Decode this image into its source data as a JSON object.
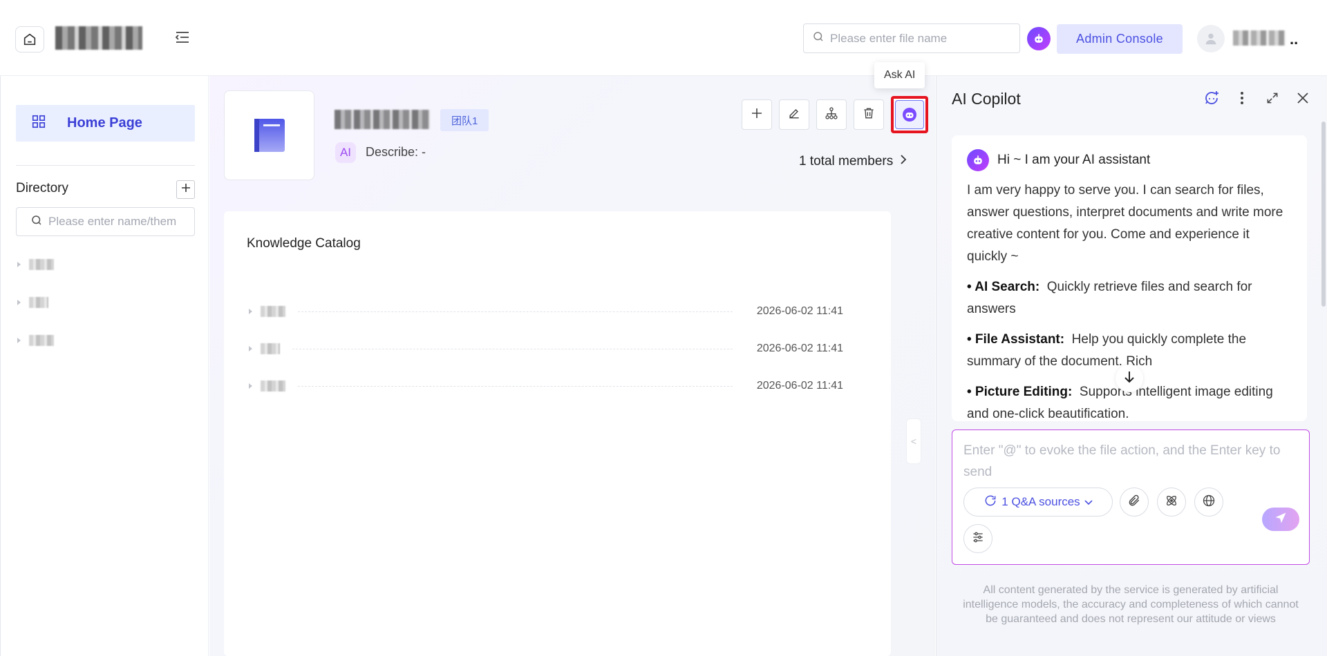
{
  "header": {
    "search_placeholder": "Please enter file name",
    "admin_console": "Admin Console",
    "user_more": ".."
  },
  "sidebar": {
    "home": "Home Page",
    "directory_title": "Directory",
    "search_placeholder": "Please enter name/them"
  },
  "kb": {
    "team_tag": "团队1",
    "ai_badge": "AI",
    "describe": "Describe: -",
    "members": "1 total members",
    "tooltip": "Ask AI"
  },
  "catalog": {
    "title": "Knowledge Catalog",
    "rows": [
      {
        "date": "2026-06-02 11:41"
      },
      {
        "date": "2026-06-02 11:41"
      },
      {
        "date": "2026-06-02 11:41"
      }
    ]
  },
  "copilot": {
    "title": "AI Copilot",
    "greeting": "Hi ~ I am your AI assistant",
    "intro": "I am very happy to serve you. I can search for files, answer questions, interpret documents and write more creative content for you. Come and experience it quickly ~",
    "features": [
      {
        "name": "• AI Search:",
        "desc": "Quickly retrieve files and search for answers"
      },
      {
        "name": "• File Assistant:",
        "desc": "Help you quickly complete the summary of the document. Rich"
      },
      {
        "name": "• Picture Editing:",
        "desc": "Supports intelligent image editing and one-click beautification."
      }
    ],
    "input_placeholder": "Enter \"@\" to evoke the file action, and the Enter key to send",
    "qa_sources": "1 Q&A sources",
    "disclaimer": "All content generated by the service is generated by artificial intelligence models, the accuracy and completeness of which cannot be guaranteed and does not represent our attitude or views"
  },
  "colors": {
    "accent": "#4b50e0",
    "highlight_border": "#e5141f",
    "composer_border": "#c14ae6"
  },
  "icons": [
    "home-icon",
    "menu-collapse-icon",
    "search-icon",
    "robot-icon",
    "user-icon",
    "grid-icon",
    "plus-icon",
    "book-icon",
    "edit-icon",
    "org-tree-icon",
    "trash-icon",
    "chevron-right-icon",
    "new-chat-icon",
    "more-vertical-icon",
    "expand-icon",
    "close-icon",
    "arrow-down-icon",
    "refresh-icon",
    "chevron-down-icon",
    "paperclip-icon",
    "atom-icon",
    "globe-icon",
    "sliders-icon",
    "send-icon"
  ]
}
